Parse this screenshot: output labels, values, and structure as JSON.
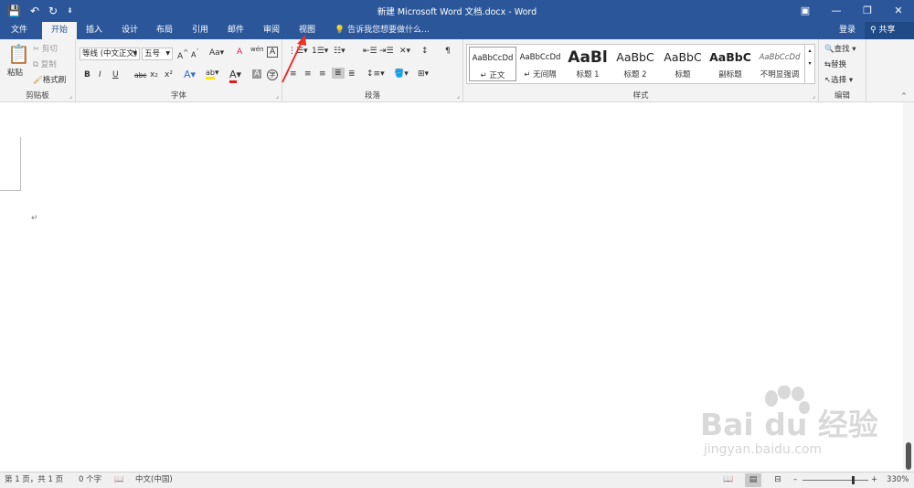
{
  "window": {
    "title": "新建 Microsoft Word 文档.docx - Word",
    "controls": {
      "options_icon": "ribbon-display-options-icon",
      "minimize": "—",
      "restore": "❐",
      "close": "✕"
    }
  },
  "quick_access": {
    "save_icon": "save-icon",
    "undo_icon": "undo-icon",
    "redo_icon": "redo-icon",
    "customize_icon": "customize-icon"
  },
  "tabs": [
    {
      "label": "文件"
    },
    {
      "label": "开始"
    },
    {
      "label": "插入"
    },
    {
      "label": "设计"
    },
    {
      "label": "布局"
    },
    {
      "label": "引用"
    },
    {
      "label": "邮件"
    },
    {
      "label": "审阅"
    },
    {
      "label": "视图"
    }
  ],
  "tellme": {
    "text": "告诉我您想要做什么..."
  },
  "account": {
    "login": "登录",
    "share": "共享"
  },
  "clipboard": {
    "paste": "粘贴",
    "cut": "剪切",
    "copy": "复制",
    "format_painter": "格式刷",
    "label": "剪贴板"
  },
  "font": {
    "family": "等线 (中文正文)",
    "size": "五号",
    "grow": "A",
    "shrink": "A",
    "change_case": "Aa",
    "clear_format": "A",
    "phonetic": "wén",
    "border_char": "A",
    "bold": "B",
    "italic": "I",
    "underline": "U",
    "strike": "abc",
    "subscript": "x₂",
    "superscript": "x²",
    "text_effect": "A",
    "highlight": "ab",
    "font_color": "A",
    "char_shading": "A",
    "enclose": "字",
    "label": "字体"
  },
  "paragraph": {
    "label": "段落"
  },
  "styles": {
    "label": "样式",
    "items": [
      {
        "preview": "AaBbCcDd",
        "name": "正文",
        "mark": "↵"
      },
      {
        "preview": "AaBbCcDd",
        "name": "无间隔",
        "mark": "↵"
      },
      {
        "preview": "AaBl",
        "name": "标题 1"
      },
      {
        "preview": "AaBbC",
        "name": "标题 2"
      },
      {
        "preview": "AaBbC",
        "name": "标题"
      },
      {
        "preview": "AaBbC",
        "name": "副标题"
      },
      {
        "preview": "AaBbCcDd",
        "name": "不明显强调"
      }
    ]
  },
  "editing": {
    "find": "查找",
    "replace": "替换",
    "select": "选择",
    "label": "编辑"
  },
  "document": {
    "para_mark": "↵"
  },
  "statusbar": {
    "page": "第 1 页，共 1 页",
    "words": "0 个字",
    "language": "中文(中国)",
    "zoom": "330%"
  },
  "watermark": {
    "brand": "Bai du 经验",
    "url": "jingyan.baidu.com"
  },
  "colors": {
    "accent": "#2b579a",
    "share_bg": "#1f4a85",
    "ribbon_bg": "#f3f3f3",
    "annotation_arrow": "#e8322a"
  }
}
